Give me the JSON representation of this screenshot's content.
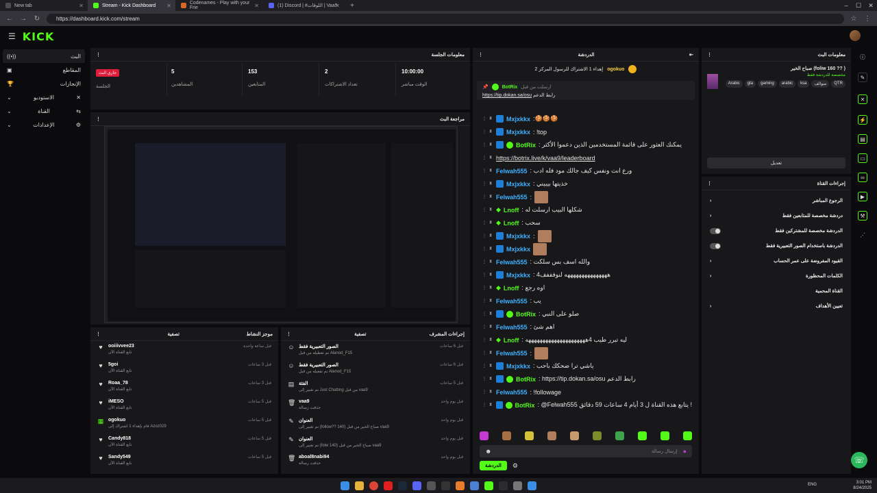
{
  "browser": {
    "tabs": [
      {
        "label": "New tab",
        "color": "#4d4d52"
      },
      {
        "label": "Stream - Kick Dashboard",
        "color": "#53fc18"
      },
      {
        "label": "Codenames - Play with your Frie",
        "color": "#d46a2a"
      },
      {
        "label": "(1) Discord | #اللوقات | Vaa9",
        "color": "#5865f2"
      }
    ],
    "url": "https://dashboard.kick.com/stream"
  },
  "app": {
    "logo": "KICK",
    "nav": [
      {
        "label": "البث",
        "icon": "live-icon"
      },
      {
        "label": "المقاطع",
        "icon": "clip-icon"
      },
      {
        "label": "الإنجازات",
        "icon": "trophy-icon"
      },
      {
        "label": "الاستوديو",
        "icon": "studio-icon"
      },
      {
        "label": "القناة",
        "icon": "channel-icon"
      },
      {
        "label": "الإعدادات",
        "icon": "settings-icon"
      }
    ]
  },
  "session": {
    "title": "معلومات الجلسة",
    "stats": [
      {
        "value": "جاري البث",
        "label": "الجلسة",
        "badge": true
      },
      {
        "value": "5",
        "label": "المشاهدين"
      },
      {
        "value": "153",
        "label": "المتابعين"
      },
      {
        "value": "2",
        "label": "تعداد الاشتراكات"
      },
      {
        "value": "10:00:00",
        "label": "الوقت مباشر"
      }
    ]
  },
  "preview": {
    "title": "مراجعة البث"
  },
  "activity": {
    "title": "موجز النشاط",
    "filter": "تصفية",
    "items": [
      {
        "name": "ooiiivvee23",
        "sub": "تابع القناة الآن",
        "time": "قبل ساعة واحدة",
        "icon": "heart-icon"
      },
      {
        "name": "5goi",
        "sub": "تابع القناة الآن",
        "time": "قبل 3 ساعات",
        "icon": "heart-icon"
      },
      {
        "name": "Roaa_78",
        "sub": "تابع القناة الآن",
        "time": "قبل 3 ساعات",
        "icon": "heart-icon"
      },
      {
        "name": "iMESO",
        "sub": "تابع القناة الآن",
        "time": "قبل 5 ساعات",
        "icon": "heart-icon"
      },
      {
        "name": "ogokuo",
        "sub": "قام بإهداء 1 اشتراك إلى Azoz029",
        "time": "قبل 5 ساعات",
        "icon": "gift-icon"
      },
      {
        "name": "Candy818",
        "sub": "تابع القناة الآن",
        "time": "قبل 5 ساعات",
        "icon": "heart-icon"
      },
      {
        "name": "Sandy549",
        "sub": "تابع القناة الآن",
        "time": "قبل 5 ساعات",
        "icon": "heart-icon"
      }
    ]
  },
  "modlog": {
    "title": "إجراءات المشرف",
    "filter": "تصفية",
    "items": [
      {
        "title": "الصور التعبيرية فقط",
        "sub": "تم تعطيله من قبل Alanod_F15",
        "time": "قبل 6 ساعات",
        "icon": "smile-icon"
      },
      {
        "title": "الصور التعبيرية فقط",
        "sub": "تم تفعيله من قبل Alanod_F15",
        "time": "قبل 6 ساعات",
        "icon": "smile-icon"
      },
      {
        "title": "الفئة",
        "sub": "تم تغيير إلى Just Chatting من قبل vaa9",
        "time": "قبل 5 ساعات",
        "icon": "folder-icon"
      },
      {
        "title": "vaa9",
        "sub": "حذفت رسالة",
        "time": "قبل يوم واحد",
        "icon": "trash-icon"
      },
      {
        "title": "العنوان",
        "sub": "تم تغيير إلى (follow?? 140) صباح الخير من قبل vaa9",
        "time": "قبل يوم واحد",
        "icon": "edit-icon"
      },
      {
        "title": "العنوان",
        "sub": "تم تغيير إلى (folw 140) صباح الخير من قبل vaa9",
        "time": "قبل يوم واحد",
        "icon": "edit-icon"
      },
      {
        "title": "aboal8nabi94",
        "sub": "حذفت رسالة",
        "time": "قبل يوم واحد",
        "icon": "trash-icon"
      }
    ]
  },
  "chat": {
    "title": "الدردشة",
    "gift_banner": "إهداء 1 الاشتراك للرسول المركز 2",
    "gifter": "ogokuo",
    "pinned_user": "BotRix",
    "pinned_text": "رابط الدعم",
    "pinned_link": "https://tip.dokan.sa/osu",
    "pinned_meta": "ارسلت من قبل",
    "messages": [
      {
        "user": "Mxjxkkx",
        "color": "#3fb0ff",
        "badge": "k",
        "text": ":🍪🍪🍪"
      },
      {
        "user": "Mxjxkkx",
        "color": "#3fb0ff",
        "badge": "k",
        "text": ": !top"
      },
      {
        "user": "BotRix",
        "color": "#53fc18",
        "badge": "kv",
        "text": ": يمكنك العثور على قائمة المستخدمين الذين دعموا الأكثر"
      },
      {
        "user": "",
        "color": "#53fc18",
        "badge": "",
        "text": "https://botrix.live/k/vaa9/leaderboard",
        "link": true
      },
      {
        "user": "Felwah555",
        "color": "#3fb0ff",
        "badge": "",
        "text": ": ورع انت ونفس كيف جالك مود فله ادب"
      },
      {
        "user": "Mxjxkkx",
        "color": "#3fb0ff",
        "badge": "k",
        "text": ": خذيتها بيبيني"
      },
      {
        "user": "Felwah555",
        "color": "#3fb0ff",
        "badge": "",
        "text": ":",
        "emoji": true
      },
      {
        "user": "Lnoff",
        "color": "#53fc18",
        "badge": "d",
        "text": ": شكلها البيب ارسلت له"
      },
      {
        "user": "Lnoff",
        "color": "#53fc18",
        "badge": "d",
        "text": ": سحب"
      },
      {
        "user": "Mxjxkkx",
        "color": "#3fb0ff",
        "badge": "k",
        "text": ":",
        "emoji": true
      },
      {
        "user": "Mxjxkkx",
        "color": "#3fb0ff",
        "badge": "k",
        "text": "",
        "emoji": true
      },
      {
        "user": "Felwah555",
        "color": "#3fb0ff",
        "badge": "",
        "text": ": والله اسف بس سلكت"
      },
      {
        "user": "Mxjxkkx",
        "color": "#3fb0ff",
        "badge": "k",
        "text": ": 4هههههههههههههههه لنوفففف"
      },
      {
        "user": "Lnoff",
        "color": "#53fc18",
        "badge": "d",
        "text": ": اوه رجع"
      },
      {
        "user": "Felwah555",
        "color": "#3fb0ff",
        "badge": "",
        "text": ": يب"
      },
      {
        "user": "BotRix",
        "color": "#53fc18",
        "badge": "kv",
        "text": ": صلو على النبي"
      },
      {
        "user": "Felwah555",
        "color": "#3fb0ff",
        "badge": "",
        "text": ": اهم شئ"
      },
      {
        "user": "Lnoff",
        "color": "#53fc18",
        "badge": "d",
        "text": ": ليه تبرر طيب 4هههههههههههههههههههههه"
      },
      {
        "user": "Felwah555",
        "color": "#3fb0ff",
        "badge": "",
        "text": ":",
        "emoji": true
      },
      {
        "user": "Mxjxkkx",
        "color": "#3fb0ff",
        "badge": "k",
        "text": ": ياشي ترا ضحكك باحب"
      },
      {
        "user": "BotRix",
        "color": "#53fc18",
        "badge": "kv",
        "text": ": https://tip.dokan.sa/osu رابط الدعم"
      },
      {
        "user": "Felwah555",
        "color": "#3fb0ff",
        "badge": "",
        "text": ": !followage"
      },
      {
        "user": "BotRix",
        "color": "#53fc18",
        "badge": "kv",
        "text": ": @Felwah555 يتابع هذه القناة ل 3 أيام 4 ساعات 59 دقائق !"
      }
    ],
    "input_placeholder": "إرسال رسالة",
    "send_label": "الدردشة"
  },
  "streaminfo": {
    "title": "معلومات البث",
    "stream_title": "صباح الخير (foliw 160 ?? )",
    "subtitle": "مخصصة للدردشة فقط",
    "tags": [
      "Arabic",
      "gta",
      "gaming",
      "arabic",
      "ksa",
      "سوالف",
      "QTR"
    ],
    "edit_label": "تعديل"
  },
  "channel_actions": {
    "title": "إجراءات القناة",
    "rows": [
      {
        "label": "الرجوع المباشر",
        "type": "arrow"
      },
      {
        "label": "دردشة مخصصة للمتابعين فقط",
        "type": "arrow"
      },
      {
        "label": "الدردشة مخصصة للمشتركين فقط",
        "type": "toggle"
      },
      {
        "label": "الدردشة باستخدام الصور التعبيرية فقط",
        "type": "toggle"
      },
      {
        "label": "القيود المفروضة على عمر الحساب",
        "type": "arrow"
      },
      {
        "label": "الكلمات المحظورة",
        "type": "arrow"
      },
      {
        "label": "القناة المحمية",
        "type": "label"
      },
      {
        "label": "تعيين الأهداف",
        "type": "arrow"
      }
    ]
  },
  "taskbar": {
    "lang": "ENG",
    "time": "3:01 PM",
    "date": "8/24/2025"
  }
}
